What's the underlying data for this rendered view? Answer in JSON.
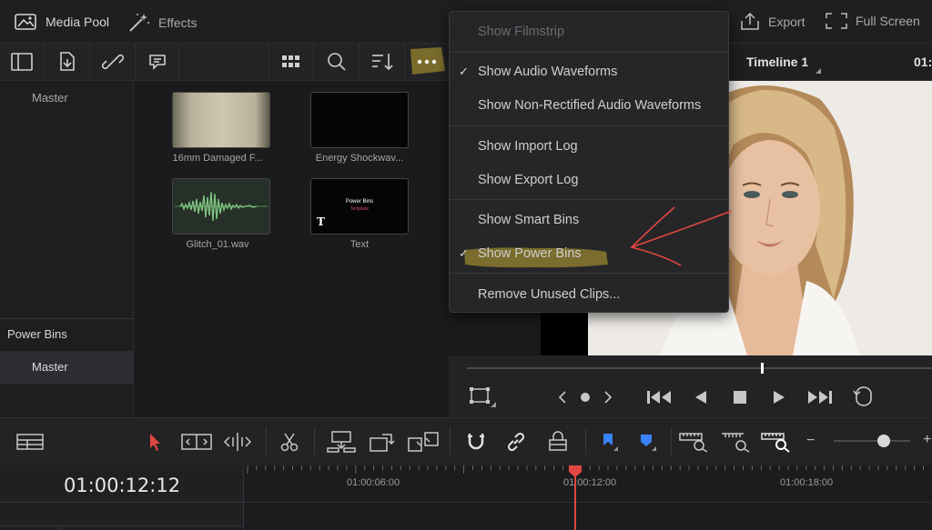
{
  "topbar": {
    "media_pool": "Media Pool",
    "effects": "Effects",
    "export": "Export",
    "full_screen": "Full Screen"
  },
  "viewer": {
    "timeline_name": "Timeline 1",
    "timecode_partial": "01:"
  },
  "bins": {
    "master": "Master",
    "power_bins_header": "Power Bins",
    "power_master": "Master"
  },
  "clips": [
    {
      "name": "16mm Damaged F...",
      "kind": "film"
    },
    {
      "name": "Energy Shockwav...",
      "kind": "black"
    },
    {
      "name": "Glitch_01.wav",
      "kind": "audio"
    },
    {
      "name": "Text",
      "kind": "text",
      "thumb_title": "Power Bins",
      "thumb_sub": "Template"
    }
  ],
  "menu": {
    "items": [
      {
        "label": "Show Filmstrip",
        "checked": false,
        "disabled": true
      },
      {
        "label": "Show Audio Waveforms",
        "checked": true,
        "disabled": false
      },
      {
        "label": "Show Non-Rectified Audio Waveforms",
        "checked": false,
        "disabled": false
      },
      {
        "label": "Show Import Log",
        "checked": false,
        "disabled": false
      },
      {
        "label": "Show Export Log",
        "checked": false,
        "disabled": false
      },
      {
        "label": "Show Smart Bins",
        "checked": false,
        "disabled": false
      },
      {
        "label": "Show Power Bins",
        "checked": true,
        "disabled": false,
        "highlighted": true
      },
      {
        "label": "Remove Unused Clips...",
        "checked": false,
        "disabled": false
      }
    ],
    "check_glyph": "✓"
  },
  "timeline": {
    "timecode": "01:00:12:12",
    "ruler_marks": [
      "01:00:06:00",
      "01:00:12:00",
      "01:00:18:00"
    ],
    "zoom_minus": "−",
    "zoom_plus": "+"
  },
  "colors": {
    "playhead": "#e0473f",
    "highlight": "#8a7a2e",
    "accent_blue": "#3b82f6",
    "annotation_red": "#e0473f"
  }
}
